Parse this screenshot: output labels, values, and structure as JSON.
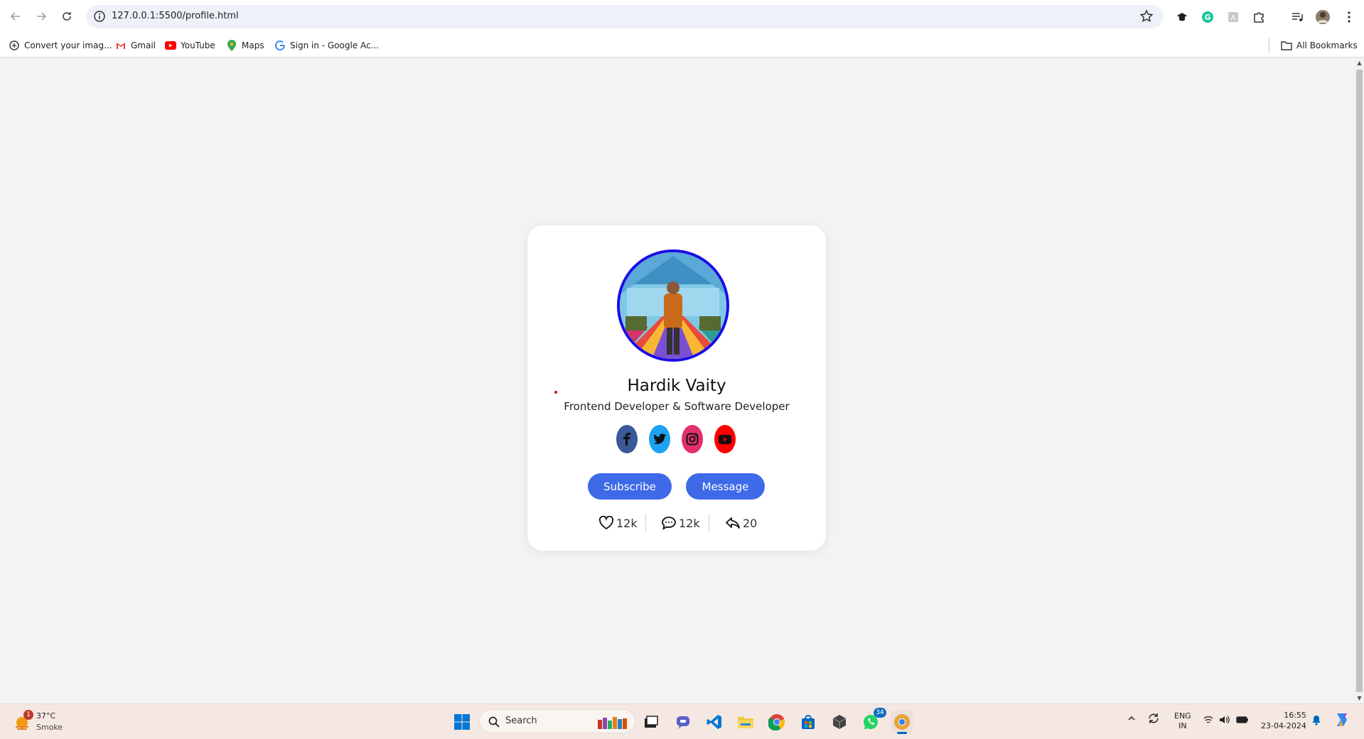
{
  "browser": {
    "url": "127.0.0.1:5500/profile.html",
    "bookmarks": [
      {
        "label": "Convert your imag...",
        "icon": "convert-icon"
      },
      {
        "label": "Gmail",
        "icon": "gmail-icon"
      },
      {
        "label": "YouTube",
        "icon": "youtube-icon"
      },
      {
        "label": "Maps",
        "icon": "maps-icon"
      },
      {
        "label": "Sign in - Google Ac...",
        "icon": "google-icon"
      }
    ],
    "all_bookmarks": "All Bookmarks"
  },
  "profile": {
    "name": "Hardik Vaity",
    "role": "Frontend Developer & Software Developer",
    "social": [
      {
        "name": "facebook",
        "glyph": "f",
        "color": "#3b5998"
      },
      {
        "name": "twitter",
        "glyph": "t",
        "color": "#1da1f2"
      },
      {
        "name": "instagram",
        "glyph": "i",
        "color": "#e1306c"
      },
      {
        "name": "youtube",
        "glyph": "y",
        "color": "#ff0000"
      }
    ],
    "buttons": {
      "subscribe": "Subscribe",
      "message": "Message"
    },
    "stats": {
      "likes": "12k",
      "comments": "12k",
      "shares": "20"
    },
    "accent": "#3e6ae8",
    "avatar_border": "#1a0ce8"
  },
  "taskbar": {
    "weather": {
      "temp": "37°C",
      "condition": "Smoke",
      "badge": "1"
    },
    "search_placeholder": "Search",
    "whatsapp_badge": "34",
    "lang": {
      "line1": "ENG",
      "line2": "IN"
    },
    "time": "16:55",
    "date": "23-04-2024"
  }
}
